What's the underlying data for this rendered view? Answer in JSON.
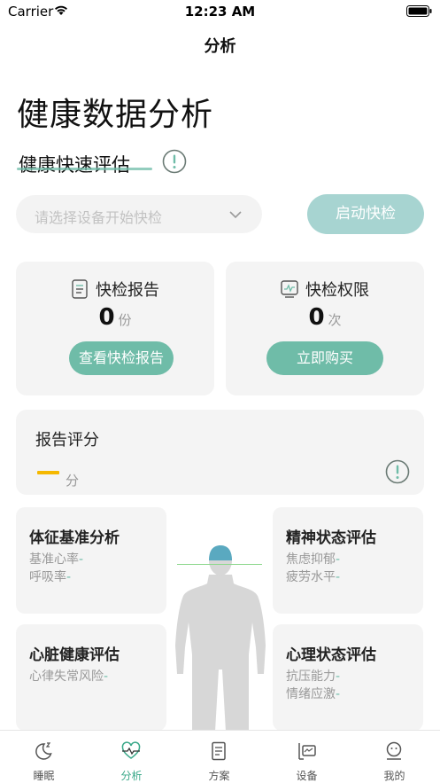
{
  "status": {
    "carrier": "Carrier",
    "time": "12:23 AM"
  },
  "nav": {
    "title": "分析"
  },
  "page": {
    "title": "健康数据分析"
  },
  "quick": {
    "section_title": "健康快速评估",
    "device_placeholder": "请选择设备开始快检",
    "start_label": "启动快检"
  },
  "report_card": {
    "title": "快检报告",
    "count": "0",
    "unit": "份",
    "button": "查看快检报告"
  },
  "perm_card": {
    "title": "快检权限",
    "count": "0",
    "unit": "次",
    "button": "立即购买"
  },
  "score": {
    "title": "报告评分",
    "unit": "分"
  },
  "evals": [
    {
      "title": "体征基准分析",
      "rows": [
        {
          "label": "基准心率",
          "value": "-"
        },
        {
          "label": "呼吸率",
          "value": "-"
        }
      ]
    },
    {
      "title": "精神状态评估",
      "rows": [
        {
          "label": "焦虑抑郁",
          "value": "-"
        },
        {
          "label": "疲劳水平",
          "value": "-"
        }
      ]
    },
    {
      "title": "心脏健康评估",
      "rows": [
        {
          "label": "心律失常风险",
          "value": "-"
        }
      ]
    },
    {
      "title": "心理状态评估",
      "rows": [
        {
          "label": "抗压能力",
          "value": "-"
        },
        {
          "label": "情绪应激",
          "value": "-"
        }
      ]
    }
  ],
  "tabs": [
    {
      "label": "睡眠",
      "icon": "sleep-icon"
    },
    {
      "label": "分析",
      "icon": "heart-pulse-icon",
      "active": true
    },
    {
      "label": "方案",
      "icon": "document-icon"
    },
    {
      "label": "设备",
      "icon": "device-icon"
    },
    {
      "label": "我的",
      "icon": "profile-icon"
    }
  ],
  "colors": {
    "accent": "#6fbca8",
    "start_button": "#a7d4d1",
    "score_dash": "#f5b800",
    "card_bg": "#f4f4f4"
  }
}
